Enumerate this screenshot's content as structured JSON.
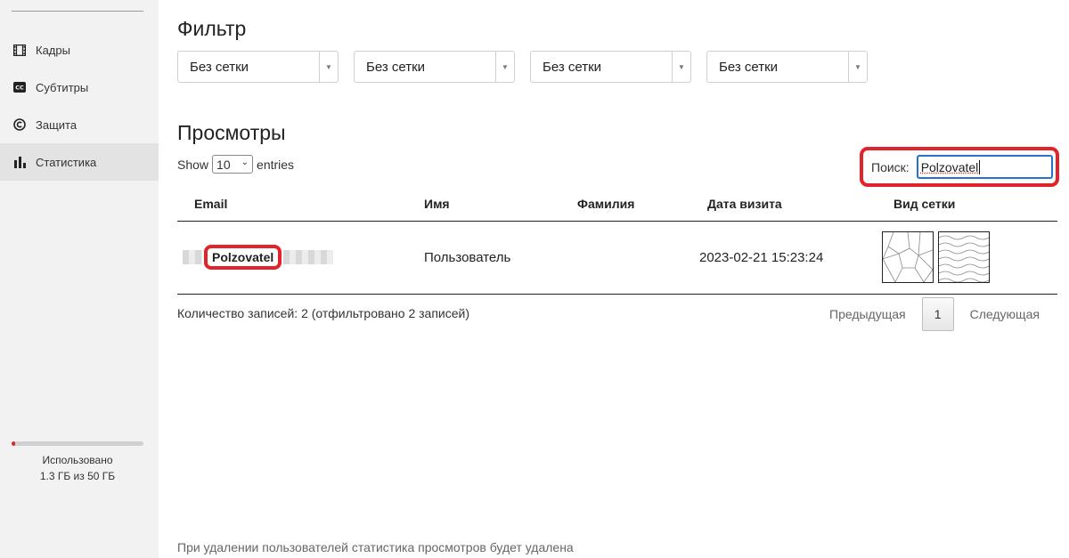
{
  "sidebar": {
    "items": [
      {
        "label": "Кадры",
        "icon": "film-icon"
      },
      {
        "label": "Субтитры",
        "icon": "cc-icon"
      },
      {
        "label": "Защита",
        "icon": "copyright-icon"
      },
      {
        "label": "Статистика",
        "icon": "bar-chart-icon",
        "active": true
      }
    ],
    "usage": {
      "label": "Использовано",
      "value": "1.3 ГБ из 50 ГБ",
      "used_fraction": 0.026,
      "bar_color": "#e0242a"
    }
  },
  "filter": {
    "title": "Фильтр",
    "selects": [
      "Без сетки",
      "Без сетки",
      "Без сетки",
      "Без сетки"
    ]
  },
  "views": {
    "title": "Просмотры",
    "length": {
      "show": "Show",
      "value": "10",
      "entries": "entries"
    },
    "search": {
      "label": "Поиск:",
      "value": "Polzovatel"
    },
    "columns": [
      "Email",
      "Имя",
      "Фамилия",
      "Дата визита",
      "Вид сетки"
    ],
    "rows": [
      {
        "email": "Polzovatel",
        "name": "Пользователь",
        "surname": "",
        "date": "2023-02-21 15:23:24",
        "grids": [
          "voronoi-grid-icon",
          "wave-grid-icon"
        ]
      }
    ],
    "info": "Количество записей: 2 (отфильтровано 2 записей)",
    "pager": {
      "prev": "Предыдущая",
      "page": "1",
      "next": "Следующая"
    }
  },
  "footer_note": "При удалении пользователей статистика просмотров будет удалена",
  "colors": {
    "highlight": "#e0242a",
    "focus": "#2a6fc9"
  }
}
